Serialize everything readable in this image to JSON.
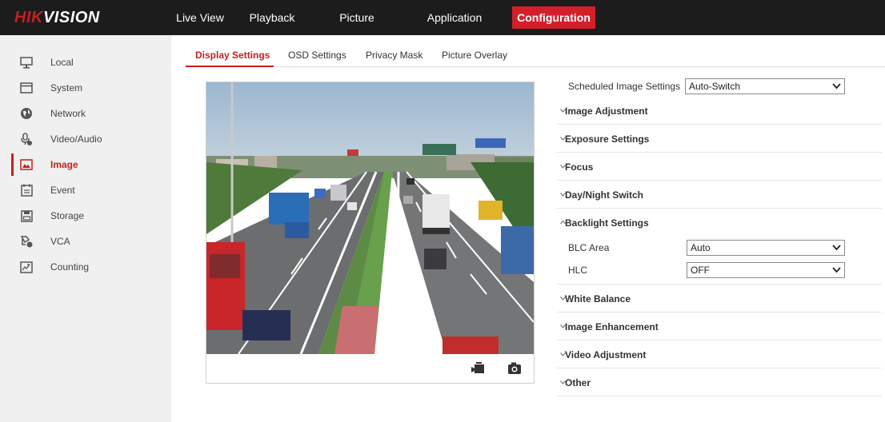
{
  "brand": {
    "part1": "HIK",
    "part2": "VISION"
  },
  "topnav": {
    "tabs": [
      {
        "label": "Live View"
      },
      {
        "label": "Playback"
      },
      {
        "label": "Picture"
      },
      {
        "label": "Application"
      },
      {
        "label": "Configuration",
        "active": true
      }
    ]
  },
  "sidebar": {
    "items": [
      {
        "label": "Local",
        "icon": "monitor-icon"
      },
      {
        "label": "System",
        "icon": "window-icon"
      },
      {
        "label": "Network",
        "icon": "globe-icon"
      },
      {
        "label": "Video/Audio",
        "icon": "microphone-icon"
      },
      {
        "label": "Image",
        "icon": "image-icon",
        "active": true
      },
      {
        "label": "Event",
        "icon": "calendar-icon"
      },
      {
        "label": "Storage",
        "icon": "storage-icon"
      },
      {
        "label": "VCA",
        "icon": "vca-icon"
      },
      {
        "label": "Counting",
        "icon": "counting-icon"
      }
    ]
  },
  "subtabs": [
    {
      "label": "Display Settings",
      "active": true
    },
    {
      "label": "OSD Settings"
    },
    {
      "label": "Privacy Mask"
    },
    {
      "label": "Picture Overlay"
    }
  ],
  "video": {
    "controls": [
      {
        "icon": "record-icon"
      },
      {
        "icon": "snapshot-camera-icon"
      }
    ]
  },
  "panel": {
    "scheduled_label": "Scheduled Image Settings",
    "scheduled_value": "Auto-Switch",
    "sections": [
      {
        "title": "Image Adjustment",
        "expanded": false
      },
      {
        "title": "Exposure Settings",
        "expanded": false
      },
      {
        "title": "Focus",
        "expanded": false
      },
      {
        "title": "Day/Night Switch",
        "expanded": false
      },
      {
        "title": "Backlight Settings",
        "expanded": true
      },
      {
        "title": "White Balance",
        "expanded": false
      },
      {
        "title": "Image Enhancement",
        "expanded": false
      },
      {
        "title": "Video Adjustment",
        "expanded": false
      },
      {
        "title": "Other",
        "expanded": false
      }
    ],
    "backlight": {
      "blc_label": "BLC Area",
      "blc_value": "Auto",
      "hlc_label": "HLC",
      "hlc_value": "OFF"
    }
  },
  "colors": {
    "accent": "#d21f2a",
    "topbar": "#1c1c1c",
    "sidebar": "#f0f0f0"
  }
}
